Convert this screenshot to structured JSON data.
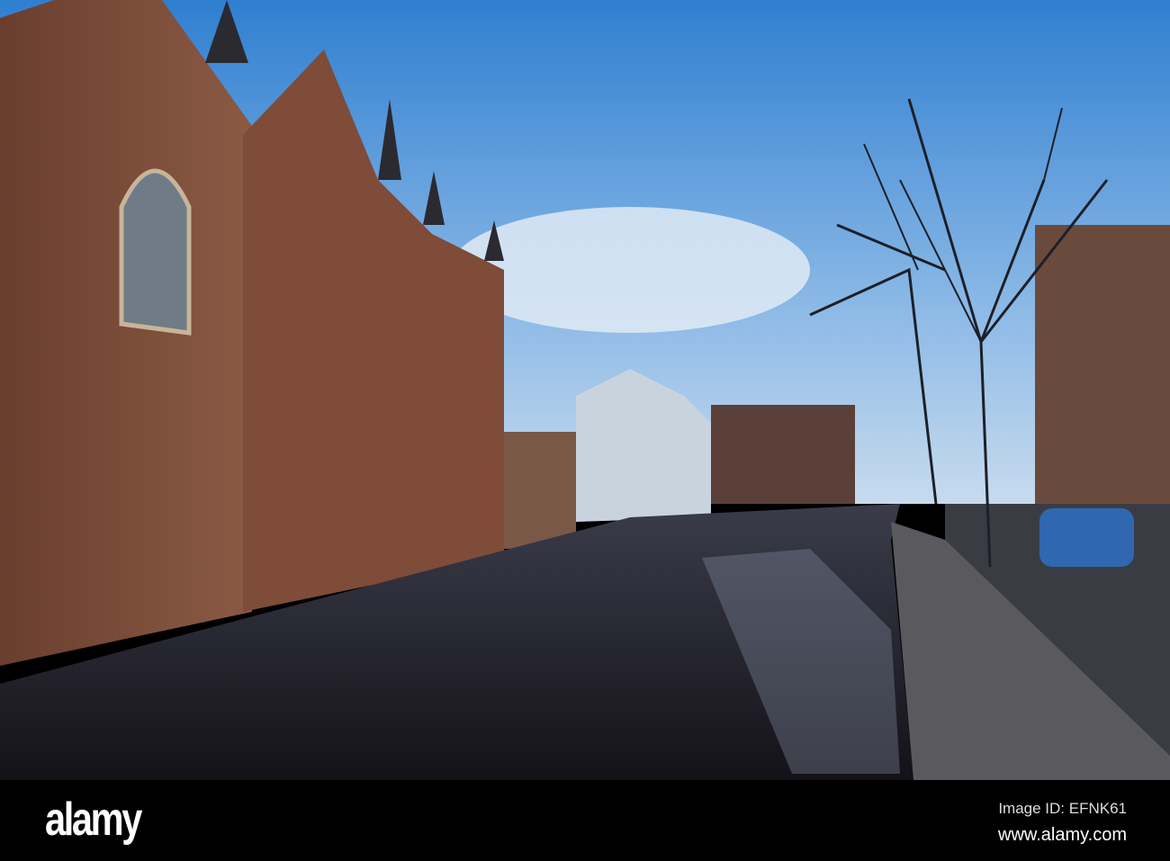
{
  "watermark": {
    "logo": "alamy",
    "image_id": "Image ID: EFNK61",
    "website": "www.alamy.com"
  },
  "colors": {
    "sky_top": "#2f7fd0",
    "sky_bottom": "#bcd6ee",
    "brick": "#7a4a36",
    "water": "#1c1a22",
    "bar": "#000000"
  }
}
